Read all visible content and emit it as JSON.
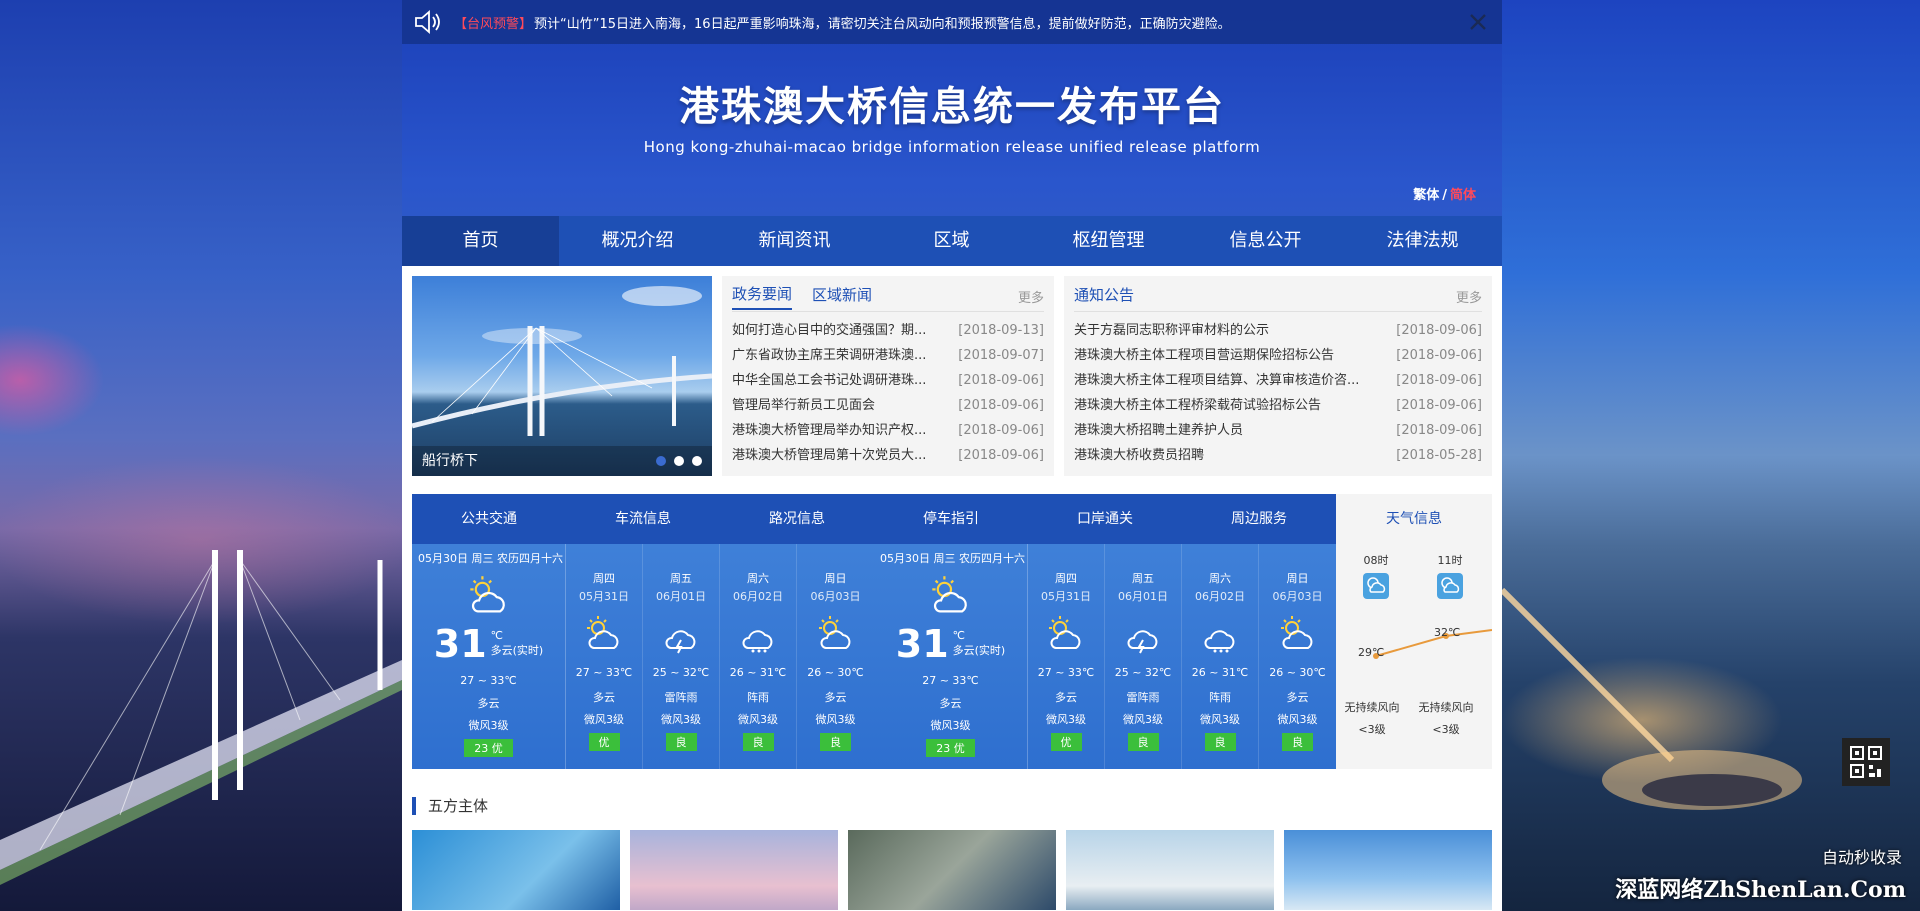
{
  "alert": {
    "tag": "【台风预警】",
    "message": "预计“山竹”15日进入南海，16日起严重影响珠海，请密切关注台风动向和预报预警信息，提前做好防范，正确防灾避险。"
  },
  "header": {
    "title": "港珠澳大桥信息统一发布平台",
    "subtitle": "Hong kong-zhuhai-macao bridge information release unified release platform",
    "lang_traditional": "繁体",
    "lang_separator": "/",
    "lang_simplified": "简体"
  },
  "nav": [
    "首页",
    "概况介绍",
    "新闻资讯",
    "区域",
    "枢纽管理",
    "信息公开",
    "法律法规"
  ],
  "slider": {
    "caption": "船行桥下"
  },
  "news": {
    "tabs": [
      "政务要闻",
      "区域新闻"
    ],
    "more": "更多",
    "items": [
      {
        "title": "如何打造心目中的交通强国？期...",
        "date": "[2018-09-13]"
      },
      {
        "title": "广东省政协主席王荣调研港珠澳...",
        "date": "[2018-09-07]"
      },
      {
        "title": "中华全国总工会书记处调研港珠...",
        "date": "[2018-09-06]"
      },
      {
        "title": "管理局举行新员工见面会",
        "date": "[2018-09-06]"
      },
      {
        "title": "港珠澳大桥管理局举办知识产权...",
        "date": "[2018-09-06]"
      },
      {
        "title": "港珠澳大桥管理局第十次党员大...",
        "date": "[2018-09-06]"
      }
    ]
  },
  "notices": {
    "tab": "通知公告",
    "more": "更多",
    "items": [
      {
        "title": "关于方磊同志职称评审材料的公示",
        "date": "[2018-09-06]"
      },
      {
        "title": "港珠澳大桥主体工程项目营运期保险招标公告",
        "date": "[2018-09-06]"
      },
      {
        "title": "港珠澳大桥主体工程项目结算、决算审核造价咨...",
        "date": "[2018-09-06]"
      },
      {
        "title": "港珠澳大桥主体工程桥梁载荷试验招标公告",
        "date": "[2018-09-06]"
      },
      {
        "title": "港珠澳大桥招聘土建养护人员",
        "date": "[2018-09-06]"
      },
      {
        "title": "港珠澳大桥收费员招聘",
        "date": "[2018-05-28]"
      }
    ]
  },
  "traffic_tabs": [
    "公共交通",
    "车流信息",
    "路况信息",
    "停车指引",
    "口岸通关",
    "周边服务"
  ],
  "weather_panel": {
    "today": {
      "date": "05月30日 周三 农历四月十六",
      "temp": "31",
      "unit": "℃",
      "desc_now": "多云(实时)",
      "range": "27 ~ 33℃",
      "desc": "多云",
      "wind": "微风3级",
      "aqi": "23 优"
    },
    "days": [
      {
        "name": "周四",
        "date": "05月31日",
        "icon": "partly-cloudy-icon",
        "range": "27 ~ 33℃",
        "desc": "多云",
        "wind": "微风3级",
        "aqi": "优"
      },
      {
        "name": "周五",
        "date": "06月01日",
        "icon": "thunder-shower-icon",
        "range": "25 ~ 32℃",
        "desc": "雷阵雨",
        "wind": "微风3级",
        "aqi": "良"
      },
      {
        "name": "周六",
        "date": "06月02日",
        "icon": "shower-icon",
        "range": "26 ~ 31℃",
        "desc": "阵雨",
        "wind": "微风3级",
        "aqi": "良"
      },
      {
        "name": "周日",
        "date": "06月03日",
        "icon": "partly-cloudy-icon",
        "range": "26 ~ 30℃",
        "desc": "多云",
        "wind": "微风3级",
        "aqi": "良"
      }
    ]
  },
  "weather_side": {
    "title": "天气信息",
    "hours": [
      {
        "time": "08时",
        "temp": "29℃",
        "wind": "无持续风向",
        "level": "<3级"
      },
      {
        "time": "11时",
        "temp": "32℃",
        "wind": "无持续风向",
        "level": "<3级"
      }
    ]
  },
  "section": {
    "title": "五方主体"
  },
  "watermark": {
    "top": "自动秒收录",
    "bottom": "深蓝网络ZhShenLan.Com"
  },
  "colors": {
    "primary": "#1e50b5",
    "alert": "#ff4a5a",
    "aqi_good": "#3bbf3b"
  }
}
